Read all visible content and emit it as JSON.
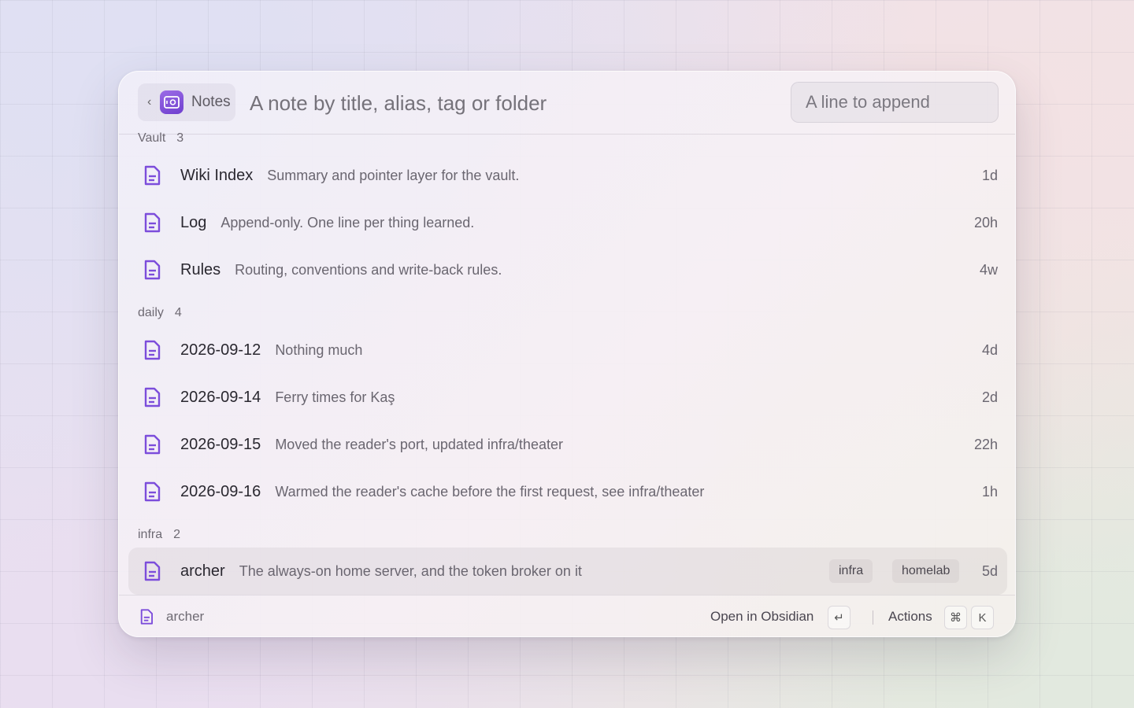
{
  "header": {
    "back_label": "Notes",
    "search_placeholder": "A note by title, alias, tag or folder",
    "append_placeholder": "A line to append"
  },
  "colors": {
    "accent": "#7c4ddb"
  },
  "sections": [
    {
      "name": "Vault",
      "count": "3",
      "items": [
        {
          "title": "Wiki Index",
          "subtitle": "Summary and pointer layer for the vault.",
          "age": "1d",
          "tags": []
        },
        {
          "title": "Log",
          "subtitle": "Append-only. One line per thing learned.",
          "age": "20h",
          "tags": []
        },
        {
          "title": "Rules",
          "subtitle": "Routing, conventions and write-back rules.",
          "age": "4w",
          "tags": []
        }
      ]
    },
    {
      "name": "daily",
      "count": "4",
      "items": [
        {
          "title": "2026-09-12",
          "subtitle": "Nothing much",
          "age": "4d",
          "tags": []
        },
        {
          "title": "2026-09-14",
          "subtitle": "Ferry times for Kaş",
          "age": "2d",
          "tags": []
        },
        {
          "title": "2026-09-15",
          "subtitle": "Moved the reader's port, updated infra/theater",
          "age": "22h",
          "tags": []
        },
        {
          "title": "2026-09-16",
          "subtitle": "Warmed the reader's cache before the first request, see infra/theater",
          "age": "1h",
          "tags": []
        }
      ]
    },
    {
      "name": "infra",
      "count": "2",
      "items": [
        {
          "title": "archer",
          "subtitle": "The always-on home server, and the token broker on it",
          "age": "5d",
          "tags": [
            "infra",
            "homelab"
          ],
          "selected": true
        }
      ]
    }
  ],
  "footer": {
    "selected_name": "archer",
    "primary_action": "Open in Obsidian",
    "primary_key": "↵",
    "actions_label": "Actions",
    "actions_keys": [
      "⌘",
      "K"
    ]
  },
  "icons": {
    "note": "note-icon",
    "extension": "safe-icon",
    "back": "chevron-left-icon"
  }
}
